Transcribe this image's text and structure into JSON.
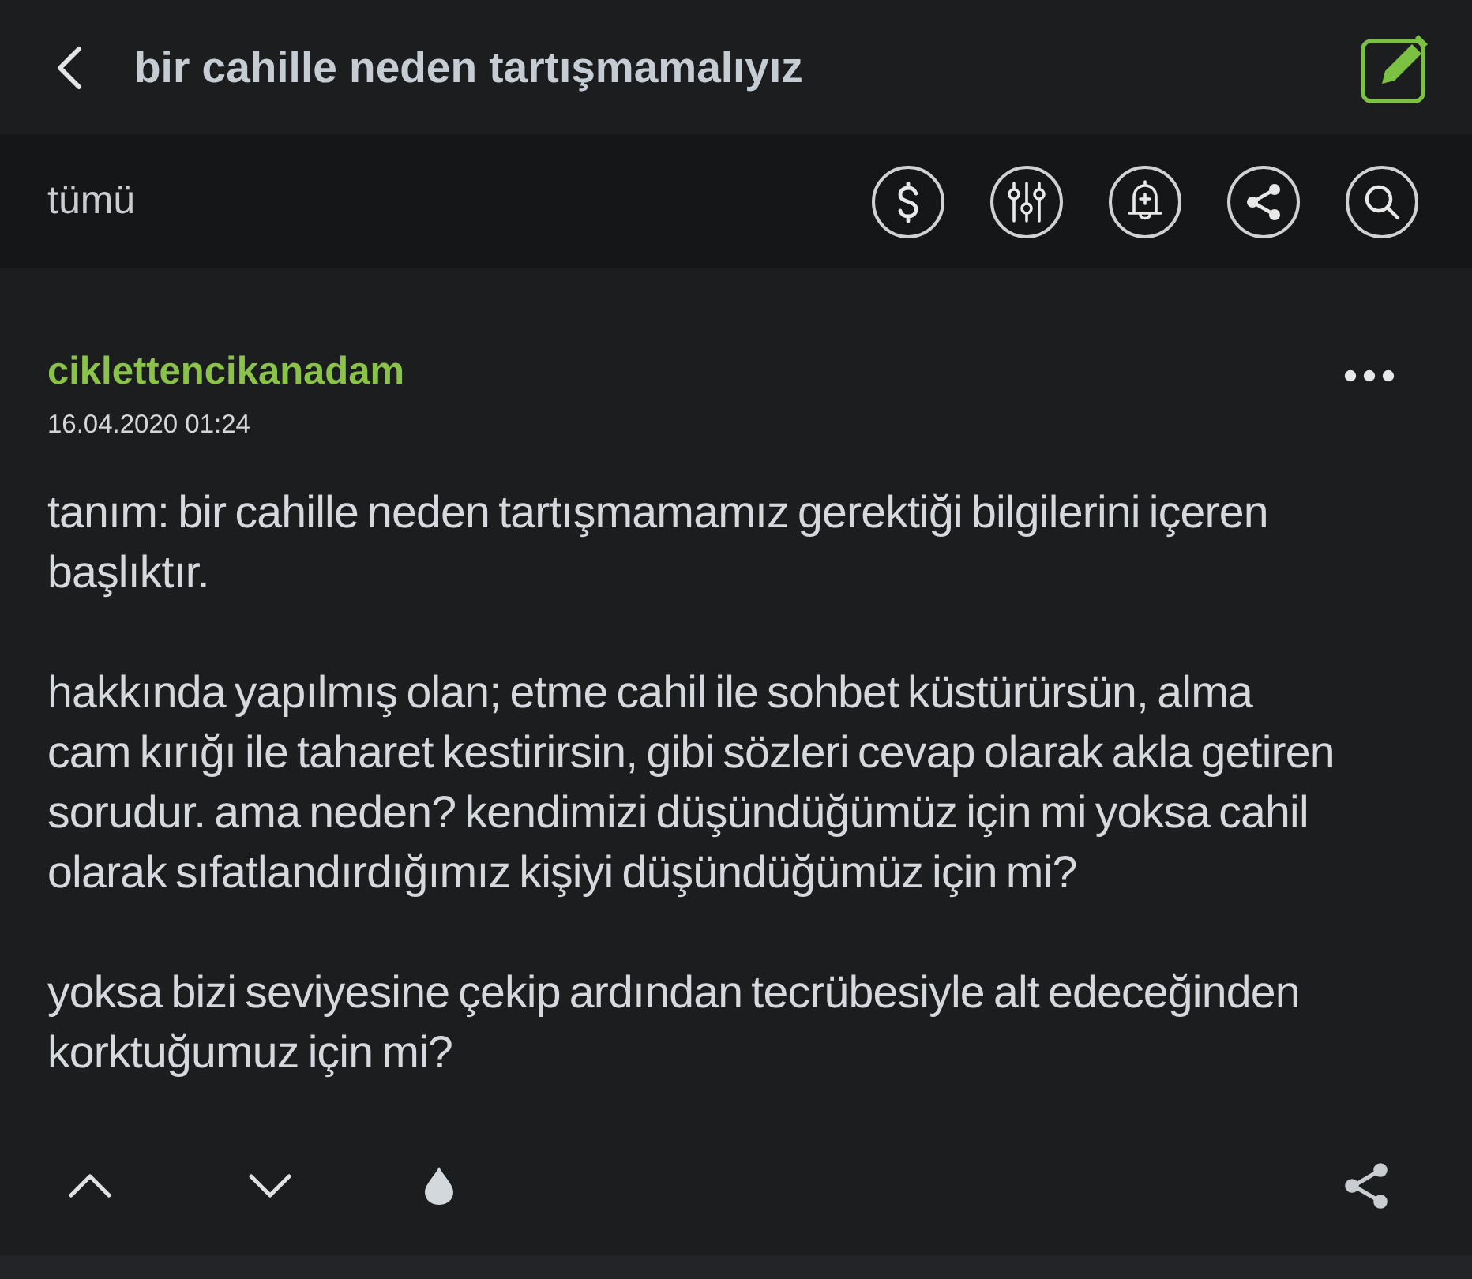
{
  "header": {
    "title": "bir cahille neden tartışmamalıyız"
  },
  "filter_bar": {
    "filter": "tümü",
    "actions": [
      {
        "kind": "dollar"
      },
      {
        "kind": "sliders"
      },
      {
        "kind": "bell"
      },
      {
        "kind": "share"
      },
      {
        "kind": "search"
      }
    ]
  },
  "entry": {
    "author": "ciklettencikanadam",
    "date": "16.04.2020 01:24",
    "paragraphs": [
      "tanım: bir cahille neden tartışmamamız gerektiği bilgilerini içeren başlıktır.",
      "hakkında yapılmış olan; etme cahil ile sohbet küstürürsün, alma cam kırığı ile taharet kestirirsin, gibi sözleri cevap olarak akla getiren sorudur. ama neden? kendimizi düşündüğümüz için mi yoksa cahil olarak sıfatlandırdığımız kişiyi düşündüğümüz için mi?",
      "yoksa bizi seviyesine çekip ardından tecrübesiyle alt edeceğinden korktuğumuz için mi?"
    ]
  },
  "footer": {
    "actions": [
      {
        "kind": "up"
      },
      {
        "kind": "down"
      },
      {
        "kind": "drop"
      },
      {
        "kind": "share"
      }
    ]
  }
}
